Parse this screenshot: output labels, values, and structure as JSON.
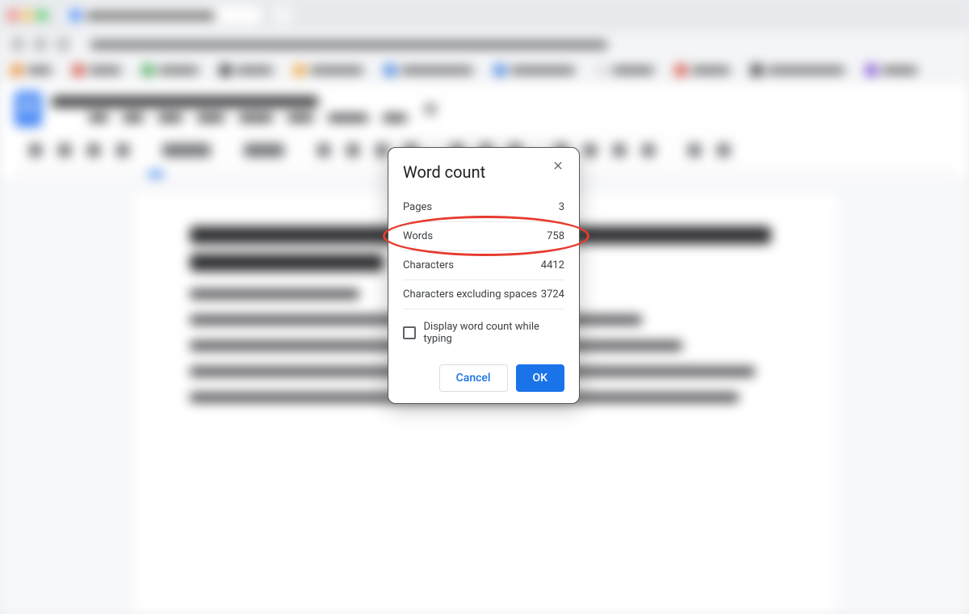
{
  "dialog": {
    "title": "Word count",
    "rows": [
      {
        "label": "Pages",
        "value": "3"
      },
      {
        "label": "Words",
        "value": "758"
      },
      {
        "label": "Characters",
        "value": "4412"
      },
      {
        "label": "Characters excluding spaces",
        "value": "3724"
      }
    ],
    "checkbox_label": "Display word count while typing",
    "cancel_label": "Cancel",
    "ok_label": "OK"
  }
}
